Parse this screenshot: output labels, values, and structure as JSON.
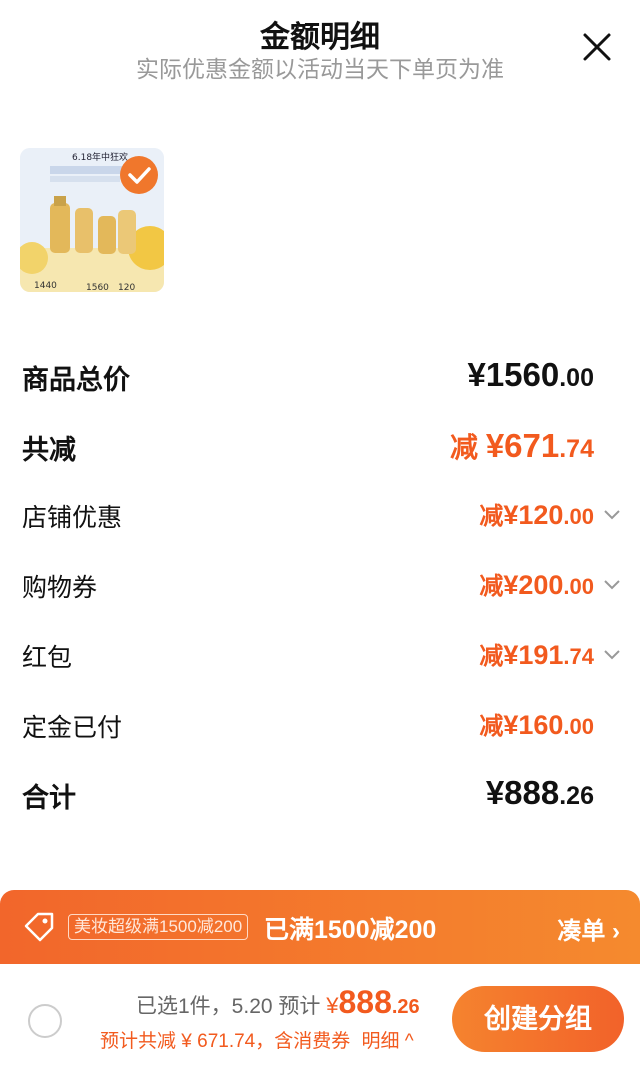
{
  "header": {
    "title": "金额明细",
    "subtitle": "实际优惠金额以活动当天下单页为准"
  },
  "product": {
    "image_text_top": "6.18年中狂欢",
    "image_prices": [
      "1440",
      "1560",
      "120"
    ]
  },
  "rows": [
    {
      "label": "商品总价",
      "prefix": "",
      "currency": "¥",
      "int": "1560",
      "dec": ".00"
    },
    {
      "label": "共减",
      "prefix": "减 ",
      "currency": "¥",
      "int": "671",
      "dec": ".74"
    },
    {
      "label": "店铺优惠",
      "prefix": "减",
      "currency": "¥",
      "int": "120",
      "dec": ".00"
    },
    {
      "label": "购物券",
      "prefix": "减",
      "currency": "¥",
      "int": "200",
      "dec": ".00"
    },
    {
      "label": "红包",
      "prefix": "减",
      "currency": "¥",
      "int": "191",
      "dec": ".74"
    },
    {
      "label": "定金已付",
      "prefix": "减",
      "currency": "¥",
      "int": "160",
      "dec": ".00"
    },
    {
      "label": "合计",
      "prefix": "",
      "currency": "¥",
      "int": "888",
      "dec": ".26"
    }
  ],
  "promo": {
    "badge": "美妆超级满1500减200",
    "reached": "已满1500减200",
    "addon": "凑单 ›"
  },
  "bottom": {
    "selected": "已选1件，5.20 预计",
    "currency": "¥",
    "total_int": "888",
    "total_dec": ".26",
    "line2": "预计共减 ¥ 671.74，含消费券",
    "detail": "明细 ^",
    "create_button": "创建分组"
  },
  "colors": {
    "accent": "#f25a1e",
    "promo_start": "#f2662b",
    "promo_end": "#f58a2e"
  }
}
